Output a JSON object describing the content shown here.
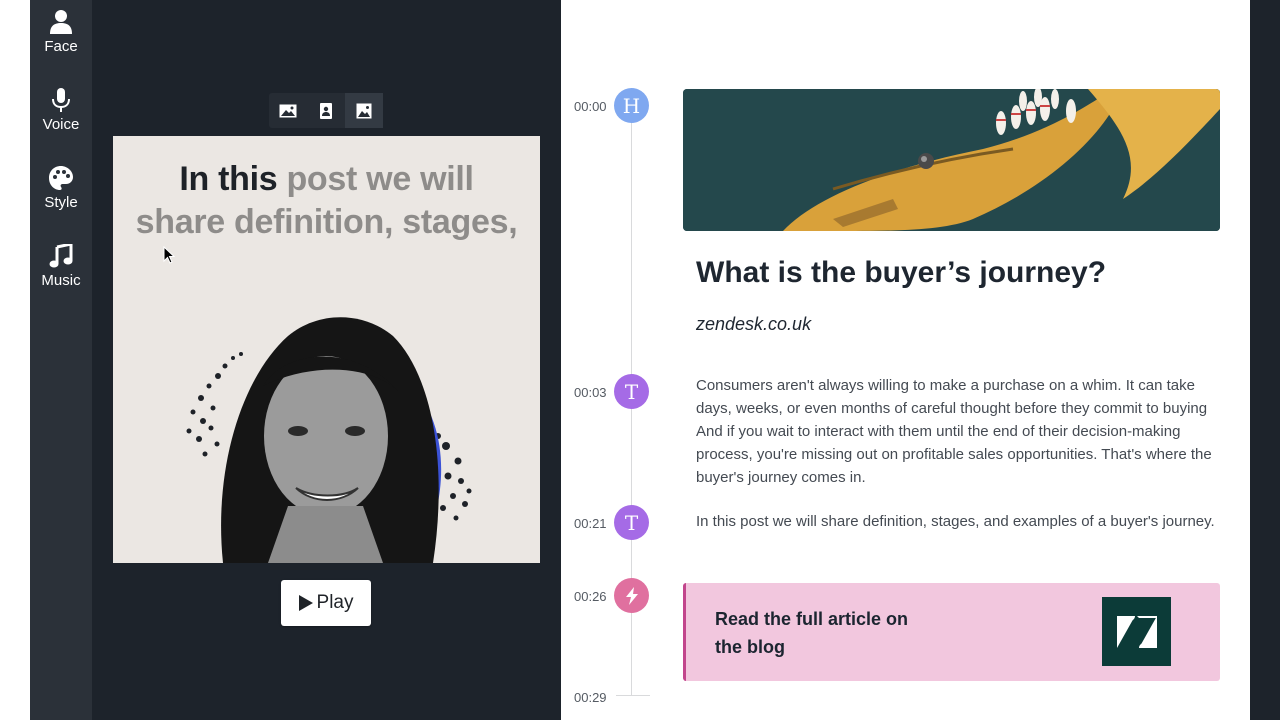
{
  "sidebar": {
    "items": [
      {
        "label": "Face",
        "icon": "person-icon"
      },
      {
        "label": "Voice",
        "icon": "microphone-icon"
      },
      {
        "label": "Style",
        "icon": "palette-icon"
      },
      {
        "label": "Music",
        "icon": "music-note-icon"
      }
    ]
  },
  "editor": {
    "layout_options": [
      "landscape-layout-icon",
      "portrait-layout-icon",
      "square-layout-icon"
    ],
    "preview": {
      "text_highlighted": "In this ",
      "text_rest": "post we will share definition, stages,"
    },
    "play_label": "Play"
  },
  "timeline": {
    "timestamps": {
      "t0": "00:00",
      "t1": "00:03",
      "t2": "00:21",
      "t3": "00:26",
      "t4": "00:29"
    },
    "nodes": {
      "heading": "H",
      "text1": "T",
      "text2": "T"
    },
    "article": {
      "title": "What is the buyer’s journey?",
      "source": "zendesk.co.uk",
      "paragraph1": "Consumers aren't always willing to make a purchase on a whim. It can take days, weeks, or even months of careful thought before they commit to buying  And if you wait to interact with them until the end of their decision-making process, you're missing out on profitable sales opportunities. That's where the buyer's journey comes in.",
      "paragraph2": "In this post we will share definition, stages, and examples of a buyer's journey."
    },
    "cta": {
      "text": "Read the full article on the blog",
      "logo": "zendesk-logo"
    }
  },
  "colors": {
    "sidebar_bg": "#2b3139",
    "editor_bg": "#1d232b",
    "node_heading": "#7fa8f0",
    "node_text": "#a56be6",
    "node_action": "#e0709f",
    "cta_bg": "#f2c7de",
    "cta_border": "#c2458c",
    "logo_bg": "#0c3b38"
  }
}
